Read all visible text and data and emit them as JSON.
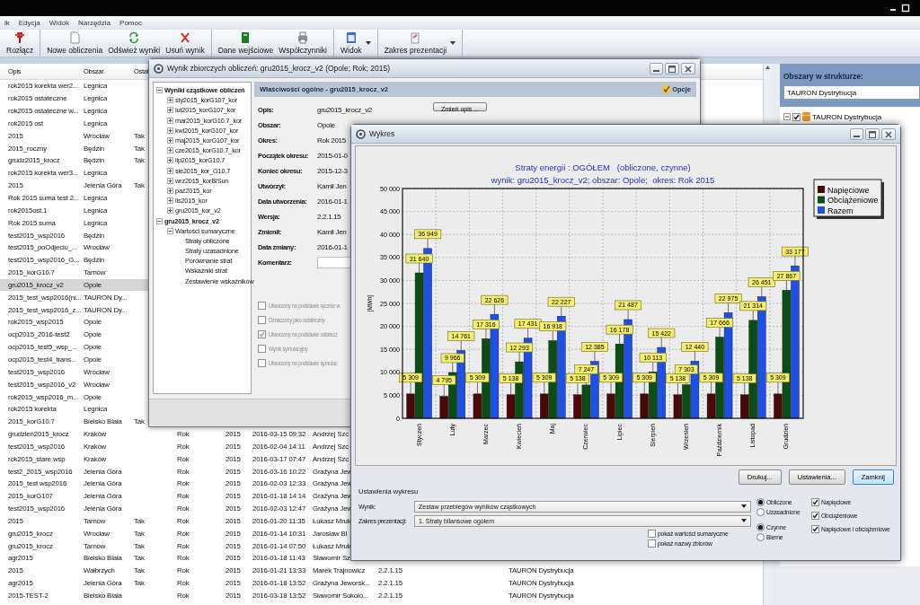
{
  "menu_bar": [
    "ik",
    "Edycja",
    "Widok",
    "Narzędzia",
    "Pomoc"
  ],
  "toolbar": [
    [
      {
        "label": "Rozłącz",
        "has_menu": false
      }
    ],
    [
      {
        "label": "Nowe obliczenia",
        "has_menu": false
      },
      {
        "label": "Odśwież wyniki",
        "has_menu": false
      },
      {
        "label": "Usuń wynik",
        "has_menu": false
      }
    ],
    [
      {
        "label": "Dane wejściowe",
        "has_menu": false
      },
      {
        "label": "Współczynniki",
        "has_menu": false
      }
    ],
    [
      {
        "label": "Widok",
        "has_menu": true
      }
    ],
    [
      {
        "label": "Zakres prezentacji",
        "has_menu": true
      }
    ]
  ],
  "table": {
    "columns": [
      "Opis",
      "Obszar",
      "Ostat"
    ],
    "rows": [
      {
        "selected": false,
        "opis": "rok2015 korekta wer2...",
        "obszar": "Legnica"
      },
      {
        "selected": false,
        "opis": "rok2015 ostateczne",
        "obszar": "Legnica"
      },
      {
        "selected": false,
        "opis": "rok2015 ostateczne w...",
        "obszar": "Legnica"
      },
      {
        "selected": false,
        "opis": "rok2015 ost",
        "obszar": "Legnica"
      },
      {
        "selected": false,
        "opis": "2015",
        "obszar": "Wrocław",
        "ostat": "Tak"
      },
      {
        "selected": false,
        "opis": "2015_roczny",
        "obszar": "Będzin",
        "ostat": "Tak"
      },
      {
        "selected": false,
        "opis": "grudz2015_krocz",
        "obszar": "Będzin",
        "ostat": "Tak"
      },
      {
        "selected": false,
        "opis": "rok2015 korekta wer3...",
        "obszar": "Legnica"
      },
      {
        "selected": false,
        "opis": "2015",
        "obszar": "Jelenia Góra",
        "ostat": "Tak"
      },
      {
        "selected": false,
        "opis": "Rok 2015 suma test 2...",
        "obszar": "Legnica"
      },
      {
        "selected": false,
        "opis": "rok2015ost.1",
        "obszar": "Legnica"
      },
      {
        "selected": false,
        "opis": "Rok 2015 suma",
        "obszar": "Legnica"
      },
      {
        "selected": false,
        "opis": "test2015_wsp2016",
        "obszar": "Będzin"
      },
      {
        "selected": false,
        "opis": "test2015_poOdjeciu_...",
        "obszar": "Wrocław"
      },
      {
        "selected": false,
        "opis": "test2015_wsp2016_G...",
        "obszar": "Będzin"
      },
      {
        "selected": false,
        "opis": "2015_korG10.7",
        "obszar": "Tarnów"
      },
      {
        "selected": true,
        "opis": "gru2015_krocz_v2",
        "obszar": "Opole"
      },
      {
        "selected": false,
        "opis": "2015_test_wsp2016(ni...",
        "obszar": "TAURON Dy..."
      },
      {
        "selected": false,
        "opis": "2015_test_wsp2016_z...",
        "obszar": "TAURON Dy..."
      },
      {
        "selected": false,
        "opis": "rok2015_wsp2015",
        "obszar": "Opole"
      },
      {
        "selected": false,
        "opis": "ocp2015_2016-test2",
        "obszar": "Opole"
      },
      {
        "selected": false,
        "opis": "ocp2015_test5_wsp_...",
        "obszar": "Opole"
      },
      {
        "selected": false,
        "opis": "ocp2015_test4_trans...",
        "obszar": "Opole"
      },
      {
        "selected": false,
        "opis": "test2015_wsp2016",
        "obszar": "Wrocław"
      },
      {
        "selected": false,
        "opis": "test2015_wsp2016_v2",
        "obszar": "Wrocław"
      },
      {
        "selected": false,
        "opis": "rok2015_wsp2016_m...",
        "obszar": "Opole"
      },
      {
        "selected": false,
        "opis": "rok2015 korekta",
        "obszar": "Legnica"
      },
      {
        "selected": false,
        "opis": "2015_korG10.7",
        "obszar": "Bielsko Biała",
        "ostat": "Tak"
      },
      {
        "selected": false,
        "opis": "grudzień2015_krocz",
        "obszar": "Kraków",
        "column_4": "Rok",
        "column_5": "2015",
        "column_6": "2016-03-15 09:32",
        "column_7": "Andrzej Szc"
      },
      {
        "selected": false,
        "opis": "test2015_wsp2016",
        "obszar": "Kraków",
        "column_4": "Rok",
        "column_5": "2015",
        "column_6": "2016-02-04 14:11",
        "column_7": "Andrzej Szc"
      },
      {
        "selected": false,
        "opis": "rok2015_stare wsp",
        "obszar": "Kraków",
        "column_4": "Rok",
        "column_5": "2015",
        "column_6": "2016-03-17 07:47",
        "column_7": "Andrzej Szc"
      },
      {
        "selected": false,
        "opis": "test2_2015_wsp2016",
        "obszar": "Jelenia Góra",
        "column_4": "Rok",
        "column_5": "2015",
        "column_6": "2016-03-16 10:22",
        "column_7": "Grażyna Jew"
      },
      {
        "selected": false,
        "opis": "2015_test wsp2016",
        "obszar": "Jelenia Góra",
        "column_4": "Rok",
        "column_5": "2015",
        "column_6": "2016-02-03 12:33",
        "column_7": "Grażyna Jew"
      },
      {
        "selected": false,
        "opis": "2015_korG107",
        "obszar": "Jelenia Góra",
        "column_4": "Rok",
        "column_5": "2015",
        "column_6": "2016-01-18 14:14",
        "column_7": "Grażyna Jew"
      },
      {
        "selected": false,
        "opis": "test2015_wsp2016",
        "obszar": "Jelenia Góra",
        "column_4": "Rok",
        "column_5": "2015",
        "column_6": "2016-02-03 12:47",
        "column_7": "Grażyna Jew"
      },
      {
        "selected": false,
        "opis": "2015",
        "obszar": "Tarnów",
        "ostat": "Tak",
        "column_4": "Rok",
        "column_5": "2015",
        "column_6": "2016-01-20 11:35",
        "column_7": "Łukasz Mruk"
      },
      {
        "selected": false,
        "opis": "gru2015_krocz",
        "obszar": "Wrocław",
        "ostat": "Tak",
        "column_4": "Rok",
        "column_5": "2015",
        "column_6": "2016-01-14 10:31",
        "column_7": "Jarosław Bl"
      },
      {
        "selected": false,
        "opis": "gru2015_krocz",
        "obszar": "Tarnów",
        "ostat": "Tak",
        "column_4": "Rok",
        "column_5": "2015",
        "column_6": "2016-01-14 07:50",
        "column_7": "Łukasz Mruk"
      },
      {
        "selected": false,
        "opis": "agr2015",
        "obszar": "Bielsko Biała",
        "ostat": "Tak",
        "column_4": "Rok",
        "column_5": "2015",
        "column_6": "2016-01-18 11:43",
        "column_7": "Sławomir Sz"
      },
      {
        "selected": false,
        "opis": "2015",
        "obszar": "Wałbrzych",
        "ostat": "Tak",
        "column_4": "Rok",
        "column_5": "2015",
        "column_6": "2016-01-21 13:33",
        "column_7": "Marek Trajnowicz",
        "column_8": "2.2.1.15",
        "column_9": "TAURON Dystrybucja"
      },
      {
        "selected": false,
        "opis": "agr2015",
        "obszar": "Jelenia Góra",
        "ostat": "Tak",
        "column_4": "Rok",
        "column_5": "2015",
        "column_6": "2016-01-18 13:52",
        "column_7": "Grażyna Jeworsk...",
        "column_8": "2.2.1.15",
        "column_9": "TAURON Dystrybucja"
      },
      {
        "selected": false,
        "opis": "2015-TEST-2",
        "obszar": "Bielsko Biała",
        "column_4": "Rok",
        "column_5": "2015",
        "column_6": "2016-03-18 13:52",
        "column_7": "Sławomir Sokoło...",
        "column_8": "2.2.1.15",
        "column_9": "TAURON Dystrybucja"
      }
    ]
  },
  "areas_panel": {
    "title": "Obszary w strukturze:",
    "field": "TAURON Dystrybucja",
    "tree": [
      {
        "label": "TAURON Dystrybucja",
        "checked": true,
        "expanded": true
      }
    ]
  },
  "summary_window": {
    "title": "Wynik zbiorczych obliczeń: gru2015_krocz_v2 (Opole; Rok; 2015)",
    "tree": [
      {
        "label": "Wyniki cząstkowe obliczeń",
        "expanded": true,
        "children": [
          {
            "label": "sty2015_korG107_kor",
            "expanded": false
          },
          {
            "label": "lut2015_korG107_kor",
            "expanded": false
          },
          {
            "label": "mar2015_korG10.7_kor",
            "expanded": false
          },
          {
            "label": "kwi2015_korG107_kor",
            "expanded": false
          },
          {
            "label": "maj2015_korG107_kor",
            "expanded": false
          },
          {
            "label": "cze2015_korG10.7_kor",
            "expanded": false
          },
          {
            "label": "lip2015_korG10.7",
            "expanded": false
          },
          {
            "label": "sie2015_kor_G10.7",
            "expanded": false
          },
          {
            "label": "wrz2015_korBISun",
            "expanded": false
          },
          {
            "label": "paz2015_kor",
            "expanded": false
          },
          {
            "label": "lis2015_kor",
            "expanded": false
          },
          {
            "label": "gru2015_kor_v2",
            "expanded": false
          }
        ]
      },
      {
        "label": "gru2015_krocz_v2",
        "expanded": true,
        "children": [
          {
            "label": "Wartości sumaryczne",
            "expanded": true,
            "children": [
              {
                "label": "Straty obliczone"
              },
              {
                "label": "Straty uzasadnione"
              },
              {
                "label": "Porównanie strat"
              },
              {
                "label": "Wskaźniki strat"
              },
              {
                "label": "Zestawienie wskaźników"
              }
            ]
          }
        ]
      }
    ],
    "header": "Właściwości ogólne - gru2015_krocz_v2",
    "options_button": "Opcje",
    "edit_button": "Zmień opis ...",
    "fields": [
      {
        "label": "Opis:",
        "kind": "text",
        "value": "gru2015_krocz_v2"
      },
      {
        "label": "Obszar:",
        "kind": "text",
        "value": "Opole"
      },
      {
        "label": "Okres:",
        "kind": "text",
        "value": "Rok 2015"
      },
      {
        "label": "Początek okresu:",
        "kind": "text",
        "value": "2015-01-0"
      },
      {
        "label": "Koniec okresu:",
        "kind": "text",
        "value": "2015-12-3"
      },
      {
        "label": "Utworzył:",
        "kind": "text",
        "value": "Kamil Jen"
      },
      {
        "label": "Data utworzenia:",
        "kind": "text",
        "value": "2016-01-1"
      },
      {
        "label": "Wersja:",
        "kind": "text",
        "value": "2.2.1.15"
      },
      {
        "label": "Zmienił:",
        "kind": "text",
        "value": "Kamil Jen"
      },
      {
        "label": "Data zmiany:",
        "kind": "text",
        "value": "2016-01-1"
      },
      {
        "label": "Komentarz:",
        "kind": "input"
      }
    ],
    "flags": [
      {
        "label": "Utworzony na podstawie ręcznie w",
        "checked": false,
        "disabled": true
      },
      {
        "label": "Oznaczony jako ostateczny",
        "checked": false,
        "disabled": true
      },
      {
        "label": "Utworzony na podstawie ostatecz",
        "checked": true,
        "disabled": true
      },
      {
        "label": "Wynik symulacyjny",
        "checked": false,
        "disabled": true
      },
      {
        "label": "Utworzony na podstawie symulac",
        "checked": false,
        "disabled": true
      }
    ]
  },
  "chart_window": {
    "title": "Wykres",
    "chart_data": {
      "type": "bar",
      "title": "Straty energii : OGÓŁEM   (obliczone, czynne)",
      "subtitle": "wynik: gru2015_krocz_v2; obszar: Opole;  okres: Rok 2015",
      "ylabel": "[MWh]",
      "categories": [
        "Styczeń",
        "Luty",
        "Marzec",
        "Kwiecień",
        "Maj",
        "Czerwiec",
        "Lipiec",
        "Sierpień",
        "Wrzesień",
        "Październik",
        "Listopad",
        "Grudzień"
      ],
      "series": [
        {
          "name": "Napięciowe",
          "color": "#4a0808",
          "values": [
            5309,
            4795,
            5309,
            5138,
            5309,
            5138,
            5309,
            5309,
            5138,
            5309,
            5138,
            5309
          ]
        },
        {
          "name": "Obciążeniowe",
          "color": "#0b4d14",
          "values": [
            31640,
            9966,
            17316,
            12293,
            16918,
            7247,
            16178,
            10113,
            7303,
            17666,
            21314,
            27867
          ]
        },
        {
          "name": "Razem",
          "color": "#1e50e6",
          "values": [
            36949,
            14761,
            22626,
            17431,
            22227,
            12385,
            21487,
            15422,
            12440,
            22975,
            26451,
            33177
          ]
        }
      ],
      "ylim": [
        0,
        50000
      ],
      "yticks": [
        {
          "value": 0,
          "label": "0"
        },
        {
          "value": 5000,
          "label": "5 000"
        },
        {
          "value": 10000,
          "label": "10 000"
        },
        {
          "value": 15000,
          "label": "15 000"
        },
        {
          "value": 20000,
          "label": "20 000"
        },
        {
          "value": 25000,
          "label": "25 000"
        },
        {
          "value": 30000,
          "label": "30 000"
        },
        {
          "value": 35000,
          "label": "35 000"
        },
        {
          "value": 40000,
          "label": "40 000"
        },
        {
          "value": 45000,
          "label": "45 000"
        },
        {
          "value": 50000,
          "label": "50 000"
        }
      ],
      "data_labels": true,
      "grid": true,
      "legend": true
    },
    "buttons": [
      {
        "label": "Drukuj...",
        "default": false
      },
      {
        "label": "Ustawienia...",
        "default": false
      },
      {
        "label": "Zamknij",
        "default": true
      }
    ],
    "settings": {
      "title": "Ustawienia wykresu",
      "selects": [
        {
          "label": "Wynik:",
          "value": "Zestaw przebiegów wyników cząstkowych"
        },
        {
          "label": "Zakres prezentacji:",
          "value": "1. Straty bilansowe ogółem"
        }
      ],
      "options": [
        {
          "label": "pokaż wartości sumaryczne",
          "checked": false
        },
        {
          "label": "pokaż nazwy zbiorów",
          "checked": false
        }
      ],
      "radio_groups": [
        [
          {
            "label": "Obliczone",
            "selected": true
          },
          {
            "label": "Uzasadnione",
            "selected": false
          }
        ],
        [
          {
            "label": "Czynne",
            "selected": true
          },
          {
            "label": "Bierne",
            "selected": false
          }
        ]
      ],
      "series_checks": [
        {
          "label": "Napięciowe",
          "checked": true
        },
        {
          "label": "Obciążeniowe",
          "checked": true
        },
        {
          "label": "Napięciowe i obciążeniowe",
          "checked": true
        }
      ]
    }
  }
}
